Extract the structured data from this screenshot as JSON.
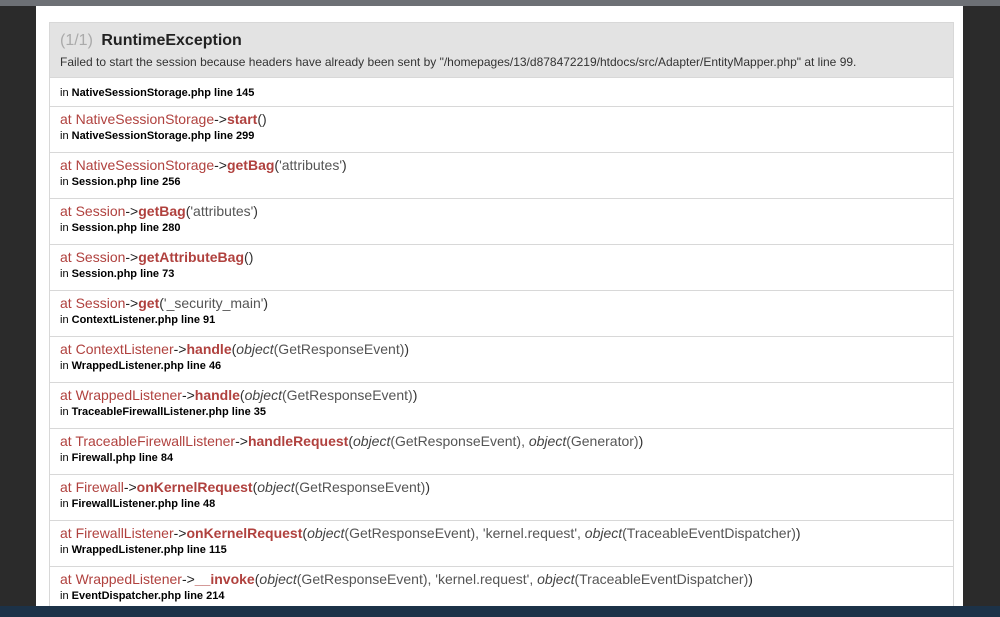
{
  "exception": {
    "counter": "(1/1)",
    "type": "RuntimeException",
    "message": "Failed to start the session because headers have already been sent by \"/homepages/13/d878472219/htdocs/src/Adapter/EntityMapper.php\" at line 99.",
    "origin": {
      "in": "in",
      "file": "NativeSessionStorage.php line 145"
    }
  },
  "trace": [
    {
      "at": "at",
      "class": "NativeSessionStorage",
      "arrow": "->",
      "method": "start",
      "open": "(",
      "args": "",
      "close": ")",
      "in": "in",
      "file": "NativeSessionStorage.php line 299"
    },
    {
      "at": "at",
      "class": "NativeSessionStorage",
      "arrow": "->",
      "method": "getBag",
      "open": "(",
      "args": "'attributes'",
      "close": ")",
      "in": "in",
      "file": "Session.php line 256"
    },
    {
      "at": "at",
      "class": "Session",
      "arrow": "->",
      "method": "getBag",
      "open": "(",
      "args": "'attributes'",
      "close": ")",
      "in": "in",
      "file": "Session.php line 280"
    },
    {
      "at": "at",
      "class": "Session",
      "arrow": "->",
      "method": "getAttributeBag",
      "open": "(",
      "args": "",
      "close": ")",
      "in": "in",
      "file": "Session.php line 73"
    },
    {
      "at": "at",
      "class": "Session",
      "arrow": "->",
      "method": "get",
      "open": "(",
      "args": "'_security_main'",
      "close": ")",
      "in": "in",
      "file": "ContextListener.php line 91"
    },
    {
      "at": "at",
      "class": "ContextListener",
      "arrow": "->",
      "method": "handle",
      "open": "(",
      "args_html": [
        [
          "i",
          "object"
        ],
        [
          "t",
          "(GetResponseEvent)"
        ]
      ],
      "close": ")",
      "in": "in",
      "file": "WrappedListener.php line 46"
    },
    {
      "at": "at",
      "class": "WrappedListener",
      "arrow": "->",
      "method": "handle",
      "open": "(",
      "args_html": [
        [
          "i",
          "object"
        ],
        [
          "t",
          "(GetResponseEvent)"
        ]
      ],
      "close": ")",
      "in": "in",
      "file": "TraceableFirewallListener.php line 35"
    },
    {
      "at": "at",
      "class": "TraceableFirewallListener",
      "arrow": "->",
      "method": "handleRequest",
      "open": "(",
      "args_html": [
        [
          "i",
          "object"
        ],
        [
          "t",
          "(GetResponseEvent), "
        ],
        [
          "i",
          "object"
        ],
        [
          "t",
          "(Generator)"
        ]
      ],
      "close": ")",
      "in": "in",
      "file": "Firewall.php line 84"
    },
    {
      "at": "at",
      "class": "Firewall",
      "arrow": "->",
      "method": "onKernelRequest",
      "open": "(",
      "args_html": [
        [
          "i",
          "object"
        ],
        [
          "t",
          "(GetResponseEvent)"
        ]
      ],
      "close": ")",
      "in": "in",
      "file": "FirewallListener.php line 48"
    },
    {
      "at": "at",
      "class": "FirewallListener",
      "arrow": "->",
      "method": "onKernelRequest",
      "open": "(",
      "args_html": [
        [
          "i",
          "object"
        ],
        [
          "t",
          "(GetResponseEvent), 'kernel.request', "
        ],
        [
          "i",
          "object"
        ],
        [
          "t",
          "(TraceableEventDispatcher)"
        ]
      ],
      "close": ")",
      "in": "in",
      "file": "WrappedListener.php line 115"
    },
    {
      "at": "at",
      "class": "WrappedListener",
      "arrow": "->",
      "method": "__invoke",
      "open": "(",
      "args_html": [
        [
          "i",
          "object"
        ],
        [
          "t",
          "(GetResponseEvent), 'kernel.request', "
        ],
        [
          "i",
          "object"
        ],
        [
          "t",
          "(TraceableEventDispatcher)"
        ]
      ],
      "close": ")",
      "in": "in",
      "file": "EventDispatcher.php line 214"
    }
  ],
  "colors": {
    "accent": "#b0413e",
    "header_bg": "#e3e3e3",
    "backdrop": "#2b2b2b"
  }
}
